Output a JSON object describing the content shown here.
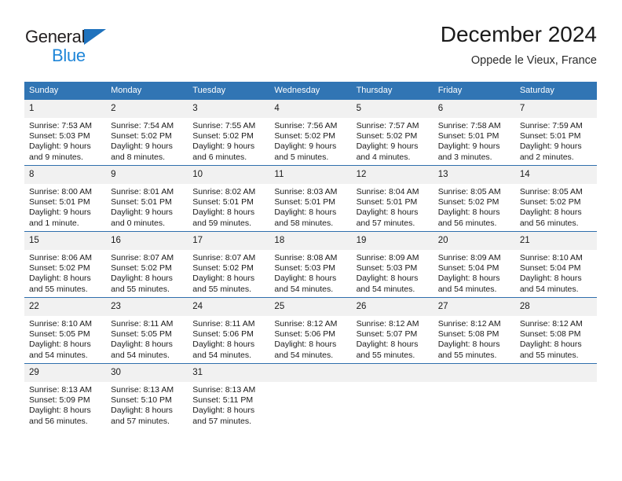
{
  "logo": {
    "word_dark": "General",
    "word_blue": "Blue",
    "triangle_icon": "triangle-icon",
    "colors": {
      "dark": "#231f20",
      "blue": "#1f86d8",
      "triangle": "#1f72bd"
    }
  },
  "header": {
    "title": "December 2024",
    "subtitle": "Oppede le Vieux, France"
  },
  "colors": {
    "header_blue": "#3175b4",
    "row_divider": "#2f6fad",
    "daynum_band": "#f1f1f1",
    "cell_background": "#ffffff"
  },
  "calendar": {
    "weekday_headers": [
      "Sunday",
      "Monday",
      "Tuesday",
      "Wednesday",
      "Thursday",
      "Friday",
      "Saturday"
    ],
    "weeks": [
      [
        {
          "day": "1",
          "sunrise": "Sunrise: 7:53 AM",
          "sunset": "Sunset: 5:03 PM",
          "daylight_line1": "Daylight: 9 hours",
          "daylight_line2": "and 9 minutes."
        },
        {
          "day": "2",
          "sunrise": "Sunrise: 7:54 AM",
          "sunset": "Sunset: 5:02 PM",
          "daylight_line1": "Daylight: 9 hours",
          "daylight_line2": "and 8 minutes."
        },
        {
          "day": "3",
          "sunrise": "Sunrise: 7:55 AM",
          "sunset": "Sunset: 5:02 PM",
          "daylight_line1": "Daylight: 9 hours",
          "daylight_line2": "and 6 minutes."
        },
        {
          "day": "4",
          "sunrise": "Sunrise: 7:56 AM",
          "sunset": "Sunset: 5:02 PM",
          "daylight_line1": "Daylight: 9 hours",
          "daylight_line2": "and 5 minutes."
        },
        {
          "day": "5",
          "sunrise": "Sunrise: 7:57 AM",
          "sunset": "Sunset: 5:02 PM",
          "daylight_line1": "Daylight: 9 hours",
          "daylight_line2": "and 4 minutes."
        },
        {
          "day": "6",
          "sunrise": "Sunrise: 7:58 AM",
          "sunset": "Sunset: 5:01 PM",
          "daylight_line1": "Daylight: 9 hours",
          "daylight_line2": "and 3 minutes."
        },
        {
          "day": "7",
          "sunrise": "Sunrise: 7:59 AM",
          "sunset": "Sunset: 5:01 PM",
          "daylight_line1": "Daylight: 9 hours",
          "daylight_line2": "and 2 minutes."
        }
      ],
      [
        {
          "day": "8",
          "sunrise": "Sunrise: 8:00 AM",
          "sunset": "Sunset: 5:01 PM",
          "daylight_line1": "Daylight: 9 hours",
          "daylight_line2": "and 1 minute."
        },
        {
          "day": "9",
          "sunrise": "Sunrise: 8:01 AM",
          "sunset": "Sunset: 5:01 PM",
          "daylight_line1": "Daylight: 9 hours",
          "daylight_line2": "and 0 minutes."
        },
        {
          "day": "10",
          "sunrise": "Sunrise: 8:02 AM",
          "sunset": "Sunset: 5:01 PM",
          "daylight_line1": "Daylight: 8 hours",
          "daylight_line2": "and 59 minutes."
        },
        {
          "day": "11",
          "sunrise": "Sunrise: 8:03 AM",
          "sunset": "Sunset: 5:01 PM",
          "daylight_line1": "Daylight: 8 hours",
          "daylight_line2": "and 58 minutes."
        },
        {
          "day": "12",
          "sunrise": "Sunrise: 8:04 AM",
          "sunset": "Sunset: 5:01 PM",
          "daylight_line1": "Daylight: 8 hours",
          "daylight_line2": "and 57 minutes."
        },
        {
          "day": "13",
          "sunrise": "Sunrise: 8:05 AM",
          "sunset": "Sunset: 5:02 PM",
          "daylight_line1": "Daylight: 8 hours",
          "daylight_line2": "and 56 minutes."
        },
        {
          "day": "14",
          "sunrise": "Sunrise: 8:05 AM",
          "sunset": "Sunset: 5:02 PM",
          "daylight_line1": "Daylight: 8 hours",
          "daylight_line2": "and 56 minutes."
        }
      ],
      [
        {
          "day": "15",
          "sunrise": "Sunrise: 8:06 AM",
          "sunset": "Sunset: 5:02 PM",
          "daylight_line1": "Daylight: 8 hours",
          "daylight_line2": "and 55 minutes."
        },
        {
          "day": "16",
          "sunrise": "Sunrise: 8:07 AM",
          "sunset": "Sunset: 5:02 PM",
          "daylight_line1": "Daylight: 8 hours",
          "daylight_line2": "and 55 minutes."
        },
        {
          "day": "17",
          "sunrise": "Sunrise: 8:07 AM",
          "sunset": "Sunset: 5:02 PM",
          "daylight_line1": "Daylight: 8 hours",
          "daylight_line2": "and 55 minutes."
        },
        {
          "day": "18",
          "sunrise": "Sunrise: 8:08 AM",
          "sunset": "Sunset: 5:03 PM",
          "daylight_line1": "Daylight: 8 hours",
          "daylight_line2": "and 54 minutes."
        },
        {
          "day": "19",
          "sunrise": "Sunrise: 8:09 AM",
          "sunset": "Sunset: 5:03 PM",
          "daylight_line1": "Daylight: 8 hours",
          "daylight_line2": "and 54 minutes."
        },
        {
          "day": "20",
          "sunrise": "Sunrise: 8:09 AM",
          "sunset": "Sunset: 5:04 PM",
          "daylight_line1": "Daylight: 8 hours",
          "daylight_line2": "and 54 minutes."
        },
        {
          "day": "21",
          "sunrise": "Sunrise: 8:10 AM",
          "sunset": "Sunset: 5:04 PM",
          "daylight_line1": "Daylight: 8 hours",
          "daylight_line2": "and 54 minutes."
        }
      ],
      [
        {
          "day": "22",
          "sunrise": "Sunrise: 8:10 AM",
          "sunset": "Sunset: 5:05 PM",
          "daylight_line1": "Daylight: 8 hours",
          "daylight_line2": "and 54 minutes."
        },
        {
          "day": "23",
          "sunrise": "Sunrise: 8:11 AM",
          "sunset": "Sunset: 5:05 PM",
          "daylight_line1": "Daylight: 8 hours",
          "daylight_line2": "and 54 minutes."
        },
        {
          "day": "24",
          "sunrise": "Sunrise: 8:11 AM",
          "sunset": "Sunset: 5:06 PM",
          "daylight_line1": "Daylight: 8 hours",
          "daylight_line2": "and 54 minutes."
        },
        {
          "day": "25",
          "sunrise": "Sunrise: 8:12 AM",
          "sunset": "Sunset: 5:06 PM",
          "daylight_line1": "Daylight: 8 hours",
          "daylight_line2": "and 54 minutes."
        },
        {
          "day": "26",
          "sunrise": "Sunrise: 8:12 AM",
          "sunset": "Sunset: 5:07 PM",
          "daylight_line1": "Daylight: 8 hours",
          "daylight_line2": "and 55 minutes."
        },
        {
          "day": "27",
          "sunrise": "Sunrise: 8:12 AM",
          "sunset": "Sunset: 5:08 PM",
          "daylight_line1": "Daylight: 8 hours",
          "daylight_line2": "and 55 minutes."
        },
        {
          "day": "28",
          "sunrise": "Sunrise: 8:12 AM",
          "sunset": "Sunset: 5:08 PM",
          "daylight_line1": "Daylight: 8 hours",
          "daylight_line2": "and 55 minutes."
        }
      ],
      [
        {
          "day": "29",
          "sunrise": "Sunrise: 8:13 AM",
          "sunset": "Sunset: 5:09 PM",
          "daylight_line1": "Daylight: 8 hours",
          "daylight_line2": "and 56 minutes."
        },
        {
          "day": "30",
          "sunrise": "Sunrise: 8:13 AM",
          "sunset": "Sunset: 5:10 PM",
          "daylight_line1": "Daylight: 8 hours",
          "daylight_line2": "and 57 minutes."
        },
        {
          "day": "31",
          "sunrise": "Sunrise: 8:13 AM",
          "sunset": "Sunset: 5:11 PM",
          "daylight_line1": "Daylight: 8 hours",
          "daylight_line2": "and 57 minutes."
        },
        {
          "day": "",
          "sunrise": "",
          "sunset": "",
          "daylight_line1": "",
          "daylight_line2": ""
        },
        {
          "day": "",
          "sunrise": "",
          "sunset": "",
          "daylight_line1": "",
          "daylight_line2": ""
        },
        {
          "day": "",
          "sunrise": "",
          "sunset": "",
          "daylight_line1": "",
          "daylight_line2": ""
        },
        {
          "day": "",
          "sunrise": "",
          "sunset": "",
          "daylight_line1": "",
          "daylight_line2": ""
        }
      ]
    ]
  }
}
